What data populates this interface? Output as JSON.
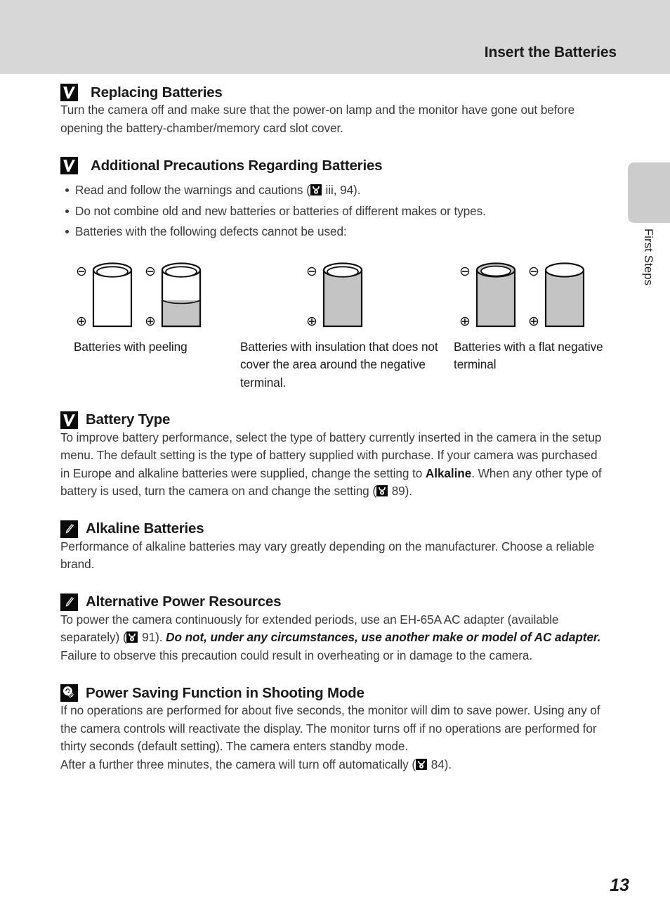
{
  "header": {
    "title": "Insert the Batteries"
  },
  "side_tab": {
    "label": "First Steps"
  },
  "page": {
    "number": "13"
  },
  "sections": [
    {
      "icon": "caution-icon",
      "title": "Replacing Batteries",
      "body": "Turn the camera off and make sure that the power-on lamp and the monitor have gone out before opening the battery-chamber/memory card slot cover."
    },
    {
      "icon": "caution-icon",
      "title": "Additional Precautions Regarding Batteries",
      "bullets": [
        {
          "pre": "Read and follow the warnings and cautions (",
          "ref": "reference-symbol",
          "post": " iii, 94)."
        },
        {
          "pre": "Do not combine old and new batteries or batteries of different makes or types.",
          "ref": null,
          "post": ""
        },
        {
          "pre": "Batteries with the following defects cannot be used:",
          "ref": null,
          "post": ""
        }
      ]
    },
    {
      "icon": "caution-icon",
      "title": "Battery Type",
      "body_1": "To improve battery performance, select the type of battery currently inserted in the camera in the setup menu. The default setting is the type of battery supplied with purchase. If your camera was purchased in Europe and alkaline batteries were supplied, change the setting to ",
      "bold_1": "Alkaline",
      "body_2": ". When any other type of battery is used, turn the camera on and change the setting (",
      "body_3": " 89)."
    },
    {
      "icon": "note-pencil-icon",
      "title": "Alkaline Batteries",
      "body": "Performance of alkaline batteries may vary greatly depending on the manufacturer. Choose a reliable brand."
    },
    {
      "icon": "note-pencil-icon",
      "title": "Alternative Power Resources",
      "body_1": "To power the camera continuously for extended periods, use an EH-65A AC adapter (available separately) (",
      "body_2": " 91). ",
      "bold_italic": "Do not, under any circumstances, use another make or model of AC adapter.",
      "body_3": " Failure to observe this precaution could result in overheating or in damage to the camera."
    },
    {
      "icon": "tip-bulb-icon",
      "title": "Power Saving Function in Shooting Mode",
      "body_1": "If no operations are performed for about five seconds, the monitor will dim to save power. Using any of the camera controls will reactivate the display. The monitor turns off if no operations are performed for thirty seconds (default setting). The camera enters standby mode.",
      "body_2_pre": "After a further three minutes, the camera will turn off automatically (",
      "body_2_post": " 84)."
    }
  ],
  "figure": {
    "batteries": [
      {
        "group": 1,
        "count": 2,
        "captionKey": "caption_1"
      },
      {
        "group": 2,
        "count": 1,
        "captionKey": "caption_2"
      },
      {
        "group": 3,
        "count": 2,
        "captionKey": "caption_3"
      }
    ],
    "caption_1": "Batteries with peeling",
    "caption_2": "Batteries with insulation that does not cover the area around the negative terminal.",
    "caption_3": "Batteries with a flat negative terminal",
    "terminal_negative": "⊖",
    "terminal_positive": "⊕"
  },
  "colors": {
    "header_band": "#d7d7d7",
    "side_tab": "#cccccc",
    "icon_fill": "#0a0a0a",
    "battery_shade": "#c4c4c4",
    "text": "#3a3a3a"
  }
}
